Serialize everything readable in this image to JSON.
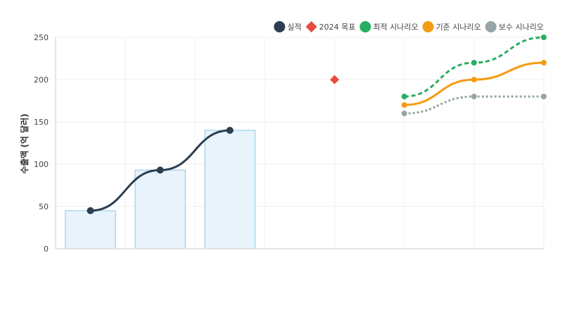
{
  "chart_data": {
    "type": "line",
    "ylabel": "수출액 (억 달러)",
    "xlabel": "",
    "ylim": [
      0,
      250
    ],
    "yticks": [
      0,
      50,
      100,
      150,
      200,
      250
    ],
    "grid": true,
    "legend_position": "top-right",
    "x_slots": 7,
    "x_tick_labels": [],
    "bar_series": {
      "name": "",
      "x": [
        0,
        1,
        2
      ],
      "values": [
        45,
        93,
        140
      ],
      "color": "#e8f3fb",
      "edge_color": "#8ec5e6"
    },
    "series": [
      {
        "name": "실적",
        "style": "solid",
        "color": "#2c3e50",
        "x": [
          0,
          1,
          2
        ],
        "values": [
          45,
          93,
          140
        ]
      },
      {
        "name": "2024 목표",
        "style": "diamond",
        "color": "#e74c3c",
        "x": [
          3.5
        ],
        "values": [
          200
        ]
      },
      {
        "name": "최적 시나리오",
        "style": "dashed",
        "color": "#27ae60",
        "x": [
          4.5,
          5.5,
          6.5
        ],
        "values": [
          180,
          220,
          250
        ]
      },
      {
        "name": "기준 시나리오",
        "style": "solid",
        "color": "#f39c12",
        "x": [
          4.5,
          5.5,
          6.5
        ],
        "values": [
          170,
          200,
          220
        ]
      },
      {
        "name": "보수 시나리오",
        "style": "dotted",
        "color": "#95a5a6",
        "x": [
          4.5,
          5.5,
          6.5
        ],
        "values": [
          160,
          180,
          180
        ]
      }
    ]
  }
}
